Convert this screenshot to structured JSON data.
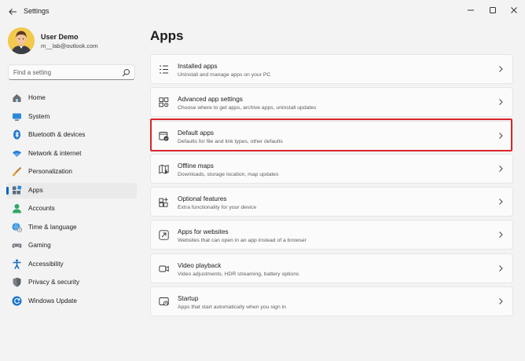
{
  "window": {
    "title": "Settings",
    "controls": [
      "minimize",
      "maximize",
      "close"
    ]
  },
  "profile": {
    "name": "User Demo",
    "email": "m__lab@outlook.com"
  },
  "search": {
    "placeholder": "Find a setting",
    "value": ""
  },
  "sidebar": {
    "items": [
      {
        "label": "Home",
        "icon": "home-icon",
        "active": false
      },
      {
        "label": "System",
        "icon": "system-icon",
        "active": false
      },
      {
        "label": "Bluetooth & devices",
        "icon": "bluetooth-icon",
        "active": false
      },
      {
        "label": "Network & internet",
        "icon": "network-icon",
        "active": false
      },
      {
        "label": "Personalization",
        "icon": "brush-icon",
        "active": false
      },
      {
        "label": "Apps",
        "icon": "apps-icon",
        "active": true
      },
      {
        "label": "Accounts",
        "icon": "accounts-icon",
        "active": false
      },
      {
        "label": "Time & language",
        "icon": "globe-clock-icon",
        "active": false
      },
      {
        "label": "Gaming",
        "icon": "gaming-icon",
        "active": false
      },
      {
        "label": "Accessibility",
        "icon": "accessibility-icon",
        "active": false
      },
      {
        "label": "Privacy & security",
        "icon": "shield-icon",
        "active": false
      },
      {
        "label": "Windows Update",
        "icon": "update-icon",
        "active": false
      }
    ]
  },
  "main": {
    "title": "Apps",
    "cards": [
      {
        "title": "Installed apps",
        "subtitle": "Uninstall and manage apps on your PC",
        "icon": "installed-apps-icon"
      },
      {
        "title": "Advanced app settings",
        "subtitle": "Choose where to get apps, archive apps, uninstall updates",
        "icon": "advanced-app-settings-icon"
      },
      {
        "title": "Default apps",
        "subtitle": "Defaults for file and link types, other defaults",
        "icon": "default-apps-icon",
        "highlighted": true
      },
      {
        "title": "Offline maps",
        "subtitle": "Downloads, storage location, map updates",
        "icon": "offline-maps-icon"
      },
      {
        "title": "Optional features",
        "subtitle": "Extra functionality for your device",
        "icon": "optional-features-icon"
      },
      {
        "title": "Apps for websites",
        "subtitle": "Websites that can open in an app instead of a browser",
        "icon": "apps-for-websites-icon"
      },
      {
        "title": "Video playback",
        "subtitle": "Video adjustments, HDR streaming, battery options",
        "icon": "video-playback-icon"
      },
      {
        "title": "Startup",
        "subtitle": "Apps that start automatically when you sign in",
        "icon": "startup-icon"
      }
    ]
  },
  "colors": {
    "accent": "#0067c0",
    "highlight_box": "#d9262c",
    "background": "#f3f3f3",
    "card": "#fbfbfb"
  }
}
